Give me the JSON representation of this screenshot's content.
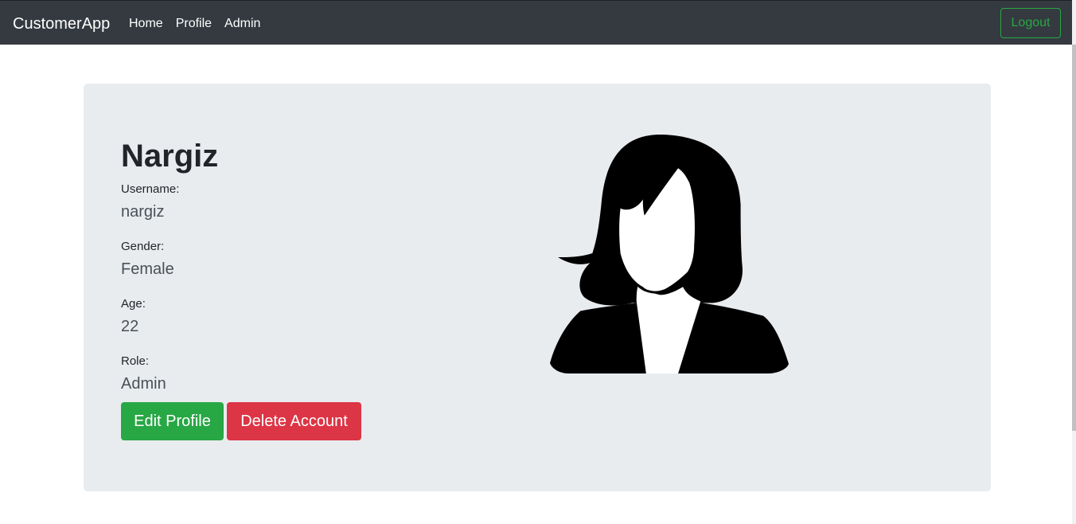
{
  "navbar": {
    "brand": "CustomerApp",
    "links": [
      "Home",
      "Profile",
      "Admin"
    ],
    "logout_label": "Logout"
  },
  "profile": {
    "name": "Nargiz",
    "fields": [
      {
        "label": "Username:",
        "value": "nargiz"
      },
      {
        "label": "Gender:",
        "value": "Female"
      },
      {
        "label": "Age:",
        "value": "22"
      },
      {
        "label": "Role:",
        "value": "Admin"
      }
    ]
  },
  "actions": {
    "edit_label": "Edit Profile",
    "delete_label": "Delete Account"
  },
  "colors": {
    "navbar_bg": "#343a40",
    "success": "#28a745",
    "danger": "#dc3545",
    "panel_bg": "#e9ecef"
  },
  "icons": {
    "avatar": "female-avatar-icon"
  }
}
